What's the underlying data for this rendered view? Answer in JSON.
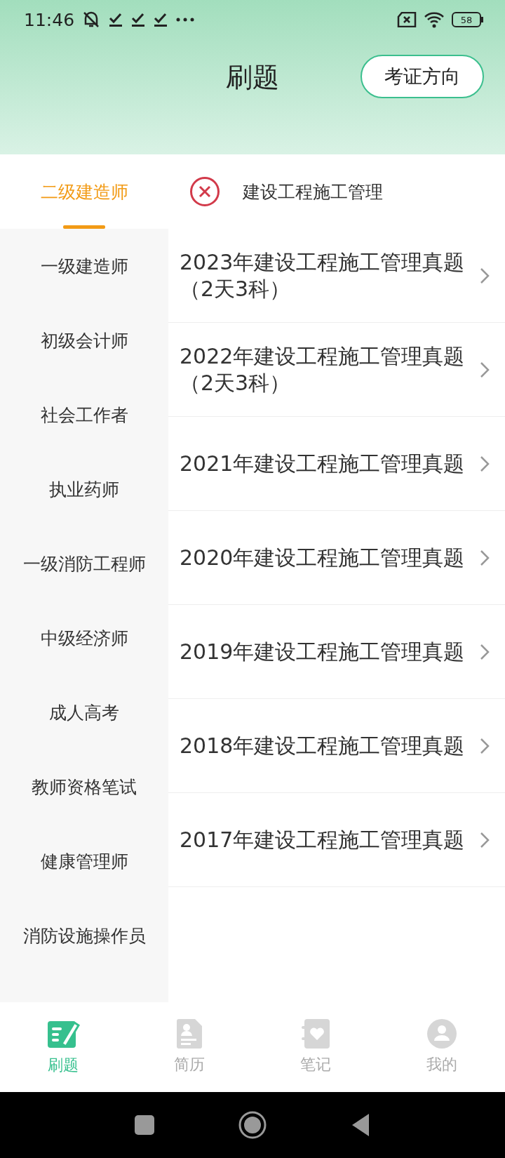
{
  "status_bar": {
    "time": "11:46",
    "battery": "58"
  },
  "header": {
    "title": "刷题",
    "action": "考证方向"
  },
  "categories": [
    {
      "label": "二级建造师",
      "selected": true
    },
    {
      "label": "一级建造师",
      "selected": false
    },
    {
      "label": "初级会计师",
      "selected": false
    },
    {
      "label": "社会工作者",
      "selected": false
    },
    {
      "label": "执业药师",
      "selected": false
    },
    {
      "label": "一级消防工程师",
      "selected": false
    },
    {
      "label": "中级经济师",
      "selected": false
    },
    {
      "label": "成人高考",
      "selected": false
    },
    {
      "label": "教师资格笔试",
      "selected": false
    },
    {
      "label": "健康管理师",
      "selected": false
    },
    {
      "label": "消防设施操作员",
      "selected": false
    }
  ],
  "subject": {
    "title": "建设工程施工管理"
  },
  "papers": [
    {
      "title": "2023年建设工程施工管理真题（2天3科）"
    },
    {
      "title": "2022年建设工程施工管理真题（2天3科）"
    },
    {
      "title": "2021年建设工程施工管理真题"
    },
    {
      "title": "2020年建设工程施工管理真题"
    },
    {
      "title": "2019年建设工程施工管理真题"
    },
    {
      "title": "2018年建设工程施工管理真题"
    },
    {
      "title": "2017年建设工程施工管理真题"
    }
  ],
  "bottom_nav": [
    {
      "label": "刷题",
      "kind": "edit",
      "selected": true
    },
    {
      "label": "简历",
      "kind": "resume",
      "selected": false
    },
    {
      "label": "笔记",
      "kind": "notes",
      "selected": false
    },
    {
      "label": "我的",
      "kind": "profile",
      "selected": false
    }
  ]
}
